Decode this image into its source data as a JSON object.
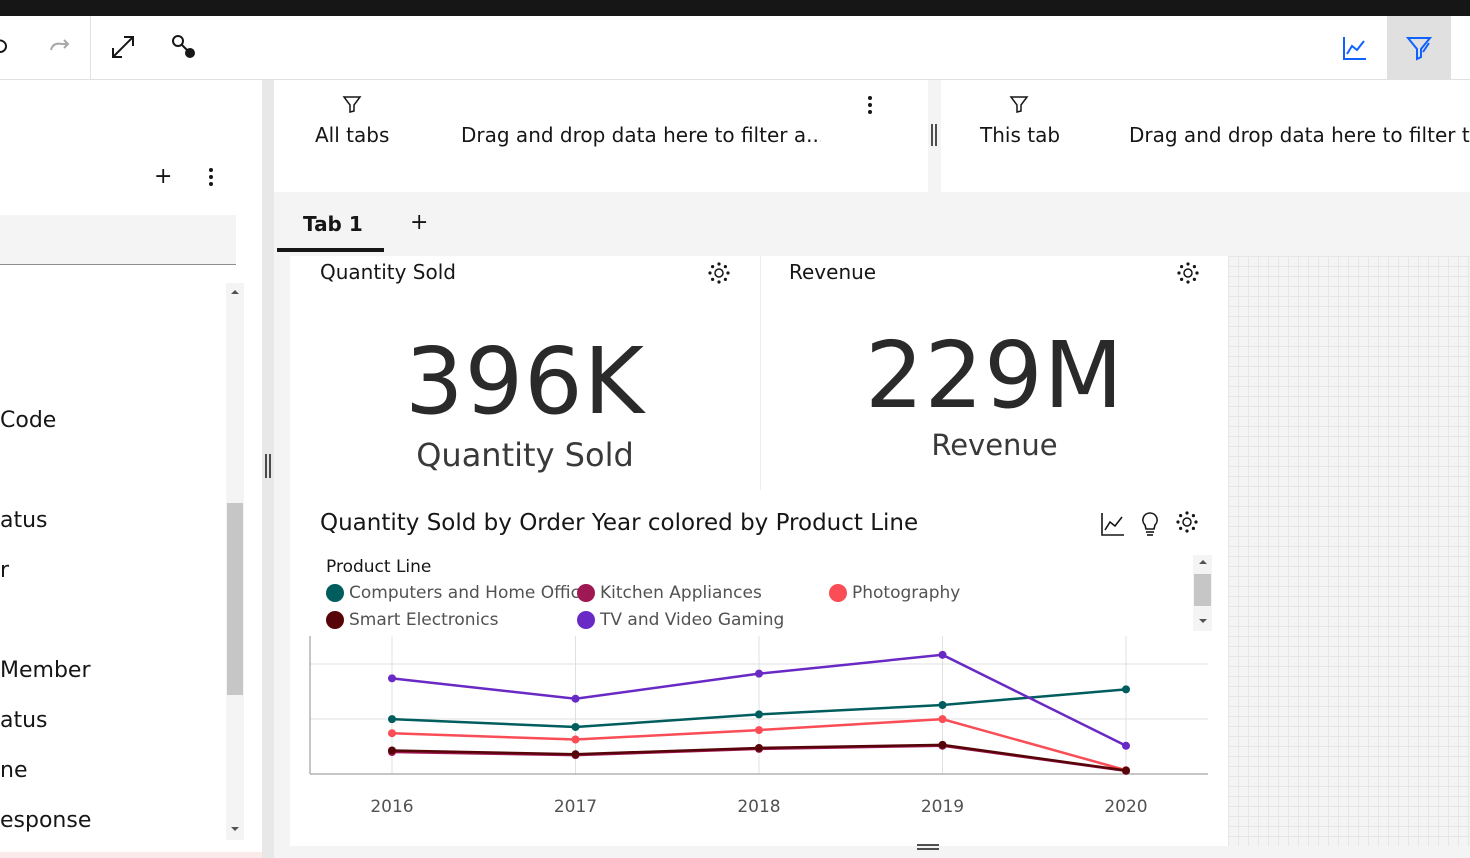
{
  "filters": {
    "all_tabs_label": "All tabs",
    "all_tabs_hint": "Drag and drop data here to filter a...",
    "this_tab_label": "This tab",
    "this_tab_hint": "Drag and drop data here to filter t..."
  },
  "left_panel": {
    "items": [
      "Code",
      "atus",
      "r",
      "Member",
      "atus",
      "ne",
      "esponse"
    ]
  },
  "tabs": {
    "active": "Tab 1",
    "add": "+"
  },
  "left_add": "+",
  "kpis": [
    {
      "title": "Quantity Sold",
      "value": "396K",
      "label": "Quantity Sold"
    },
    {
      "title": "Revenue",
      "value": "229M",
      "label": "Revenue"
    }
  ],
  "colors": {
    "computers": "#005d5d",
    "kitchen": "#9f1853",
    "photography": "#fa4d56",
    "smart": "#570408",
    "tv": "#6929c4",
    "accent": "#0f62fe"
  },
  "chart_data": {
    "type": "line",
    "title": "Quantity Sold by Order Year colored by Product Line",
    "legend_title": "Product Line",
    "legend_position": "top-left",
    "grid": true,
    "categories": [
      "2016",
      "2017",
      "2018",
      "2019",
      "2020"
    ],
    "ylim": [
      0,
      44000
    ],
    "series": [
      {
        "name": "Computers and Home Office",
        "color": "#005d5d",
        "values": [
          17500,
          15000,
          19000,
          22000,
          27000
        ]
      },
      {
        "name": "Kitchen Appliances",
        "color": "#9f1853",
        "values": [
          7000,
          6000,
          8000,
          9000,
          1000
        ]
      },
      {
        "name": "Photography",
        "color": "#fa4d56",
        "values": [
          13000,
          11000,
          14000,
          17500,
          1200
        ]
      },
      {
        "name": "Smart Electronics",
        "color": "#570408",
        "values": [
          7500,
          6300,
          8300,
          9300,
          1100
        ]
      },
      {
        "name": "TV and Video Gaming",
        "color": "#6929c4",
        "values": [
          30500,
          24000,
          32000,
          38000,
          9000
        ]
      }
    ]
  }
}
